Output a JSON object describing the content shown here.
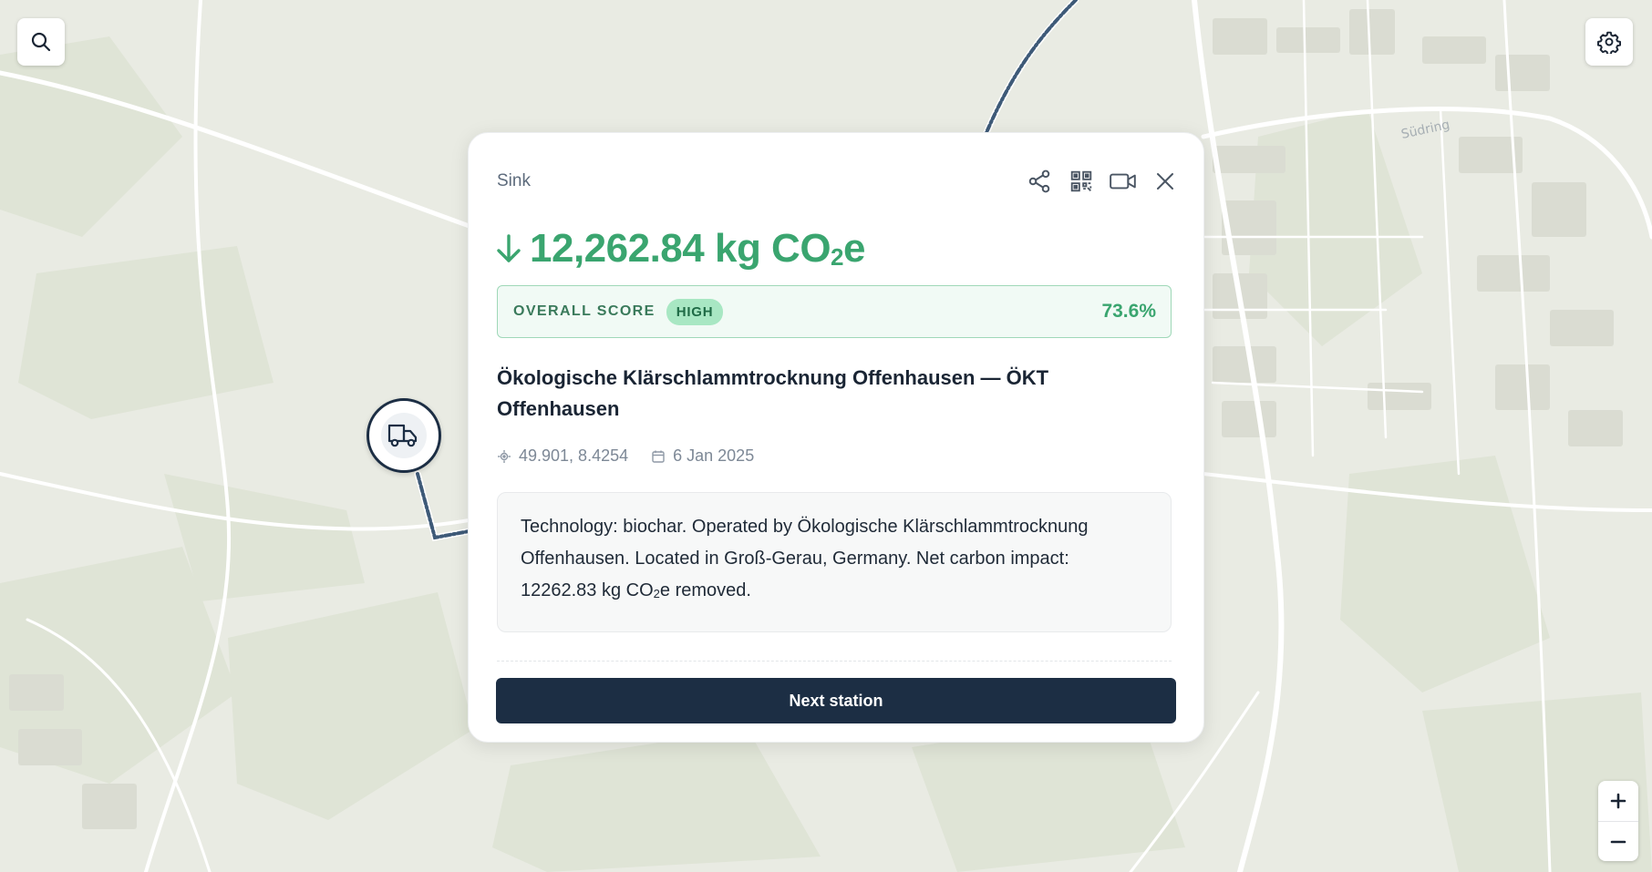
{
  "map": {
    "road_label": "Südring",
    "colors": {
      "land": "#e9ebe3",
      "green": "#dde3d4",
      "road": "#ffffff",
      "route": "#3e5a78"
    }
  },
  "controls": {
    "search_icon": "search-icon",
    "settings_icon": "gear-icon",
    "zoom_in_symbol": "+",
    "zoom_out_symbol": "−"
  },
  "marker": {
    "icon": "truck-icon"
  },
  "card": {
    "type_label": "Sink",
    "actions": [
      "share-icon",
      "qr-code-icon",
      "video-icon",
      "close-icon"
    ],
    "co2": {
      "direction_icon": "arrow-down-icon",
      "value": "12,262.84 kg CO",
      "subscript": "2",
      "suffix": "e",
      "color": "#3aa56f"
    },
    "score": {
      "label": "OVERALL SCORE",
      "badge": "HIGH",
      "percent": "73.6%"
    },
    "station_title": "Ökologische Klärschlammtrocknung Offenhausen — ÖKT Offenhausen",
    "coords": "49.901, 8.4254",
    "date": "6 Jan 2025",
    "description": {
      "text_before": "Technology: biochar. Operated by Ökologische Klärschlammtrocknung Offenhausen. Located in Groß-Gerau, Germany. Net carbon impact: 12262.83 kg CO",
      "subscript": "2",
      "text_after": "e removed."
    },
    "next_button_label": "Next station"
  }
}
